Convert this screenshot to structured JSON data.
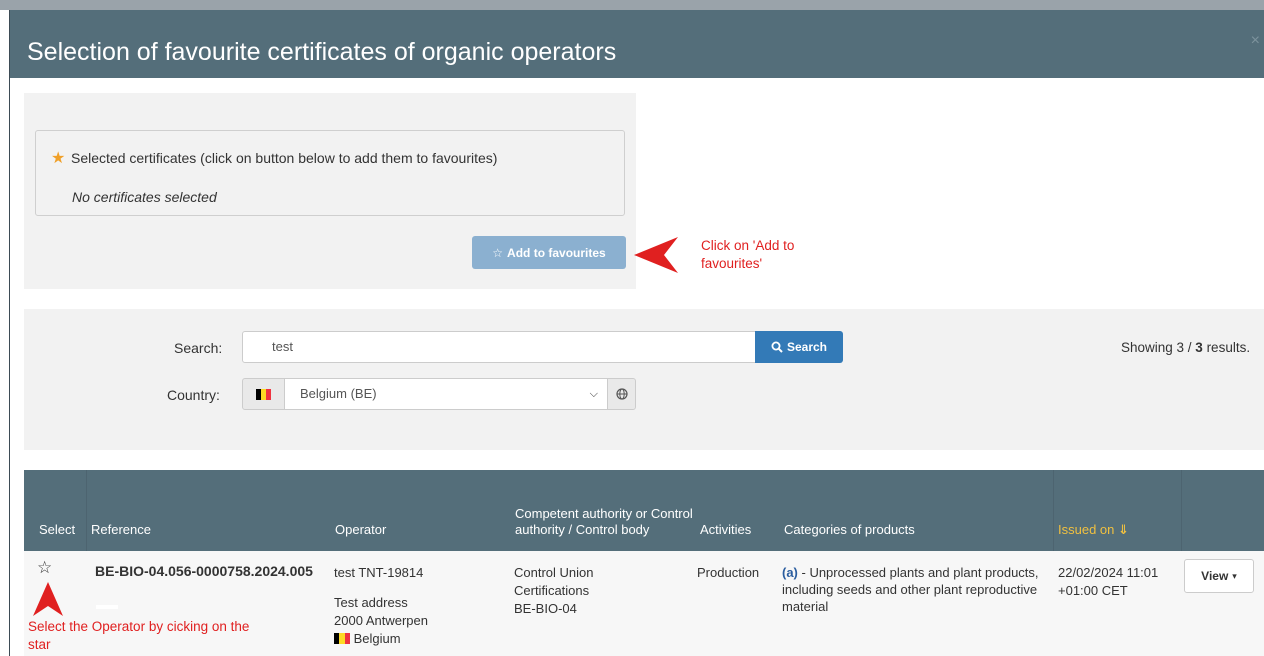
{
  "modal": {
    "title": "Selection of favourite certificates of organic operators",
    "close_glyph": "×"
  },
  "selected": {
    "heading": "Selected certificates (click on button below to add them to favourites)",
    "empty_text": "No certificates selected",
    "add_button_label": "Add to favourites"
  },
  "annotations": {
    "add_hint": "Click on 'Add to favourites'",
    "star_hint": "Select the Operator by cicking on the star"
  },
  "search": {
    "label": "Search:",
    "value": "test",
    "button_label": "Search",
    "results_prefix": "Showing 3 / ",
    "results_total": "3",
    "results_suffix": " results."
  },
  "country": {
    "label": "Country:",
    "selected": "Belgium (BE)"
  },
  "table": {
    "headers": {
      "select": "Select",
      "reference": "Reference",
      "operator": "Operator",
      "authority": "Competent authority or Control authority / Control body",
      "activities": "Activities",
      "categories": "Categories of products",
      "issued": "Issued on"
    },
    "rows": [
      {
        "reference": "BE-BIO-04.056-0000758.2024.005",
        "operator_name": "test TNT-19814",
        "operator_address": "Test address",
        "operator_city": "2000 Antwerpen",
        "operator_country": "Belgium",
        "authority_line1": "Control Union",
        "authority_line2": "Certifications",
        "authority_line3": "BE-BIO-04",
        "activity": "Production",
        "category_code": "(a)",
        "category_text": " - Unprocessed plants and plant products, including seeds and other plant reproductive material",
        "issued_line1": "22/02/2024 11:01",
        "issued_line2": "+01:00 CET",
        "view_label": "View"
      }
    ]
  },
  "colors": {
    "header_bg": "#546e7a",
    "primary_button": "#337ab7",
    "add_button": "#8bb0d0",
    "annotation": "#e02020",
    "star": "#f0a028",
    "issued_header": "#f0c040"
  },
  "icons": {
    "selected_star": "star-filled-icon",
    "add_star": "star-outline-icon",
    "search": "search-icon",
    "flag": "belgium-flag-icon",
    "globe": "globe-icon",
    "sort": "sort-icon",
    "row_select": "star-outline-icon",
    "dropdown": "caret-down-icon"
  }
}
